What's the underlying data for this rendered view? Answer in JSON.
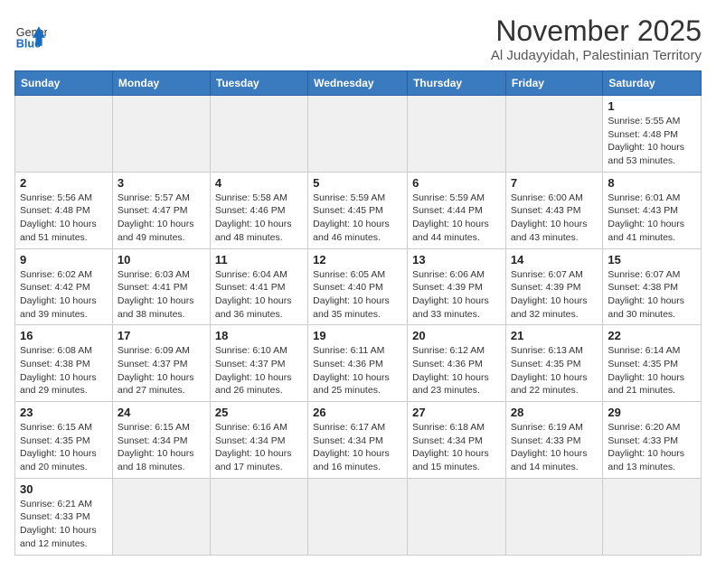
{
  "header": {
    "logo_general": "General",
    "logo_blue": "Blue",
    "month_title": "November 2025",
    "location": "Al Judayyidah, Palestinian Territory"
  },
  "weekdays": [
    "Sunday",
    "Monday",
    "Tuesday",
    "Wednesday",
    "Thursday",
    "Friday",
    "Saturday"
  ],
  "days": {
    "1": {
      "sunrise": "5:55 AM",
      "sunset": "4:48 PM",
      "daylight": "10 hours and 53 minutes."
    },
    "2": {
      "sunrise": "5:56 AM",
      "sunset": "4:48 PM",
      "daylight": "10 hours and 51 minutes."
    },
    "3": {
      "sunrise": "5:57 AM",
      "sunset": "4:47 PM",
      "daylight": "10 hours and 49 minutes."
    },
    "4": {
      "sunrise": "5:58 AM",
      "sunset": "4:46 PM",
      "daylight": "10 hours and 48 minutes."
    },
    "5": {
      "sunrise": "5:59 AM",
      "sunset": "4:45 PM",
      "daylight": "10 hours and 46 minutes."
    },
    "6": {
      "sunrise": "5:59 AM",
      "sunset": "4:44 PM",
      "daylight": "10 hours and 44 minutes."
    },
    "7": {
      "sunrise": "6:00 AM",
      "sunset": "4:43 PM",
      "daylight": "10 hours and 43 minutes."
    },
    "8": {
      "sunrise": "6:01 AM",
      "sunset": "4:43 PM",
      "daylight": "10 hours and 41 minutes."
    },
    "9": {
      "sunrise": "6:02 AM",
      "sunset": "4:42 PM",
      "daylight": "10 hours and 39 minutes."
    },
    "10": {
      "sunrise": "6:03 AM",
      "sunset": "4:41 PM",
      "daylight": "10 hours and 38 minutes."
    },
    "11": {
      "sunrise": "6:04 AM",
      "sunset": "4:41 PM",
      "daylight": "10 hours and 36 minutes."
    },
    "12": {
      "sunrise": "6:05 AM",
      "sunset": "4:40 PM",
      "daylight": "10 hours and 35 minutes."
    },
    "13": {
      "sunrise": "6:06 AM",
      "sunset": "4:39 PM",
      "daylight": "10 hours and 33 minutes."
    },
    "14": {
      "sunrise": "6:07 AM",
      "sunset": "4:39 PM",
      "daylight": "10 hours and 32 minutes."
    },
    "15": {
      "sunrise": "6:07 AM",
      "sunset": "4:38 PM",
      "daylight": "10 hours and 30 minutes."
    },
    "16": {
      "sunrise": "6:08 AM",
      "sunset": "4:38 PM",
      "daylight": "10 hours and 29 minutes."
    },
    "17": {
      "sunrise": "6:09 AM",
      "sunset": "4:37 PM",
      "daylight": "10 hours and 27 minutes."
    },
    "18": {
      "sunrise": "6:10 AM",
      "sunset": "4:37 PM",
      "daylight": "10 hours and 26 minutes."
    },
    "19": {
      "sunrise": "6:11 AM",
      "sunset": "4:36 PM",
      "daylight": "10 hours and 25 minutes."
    },
    "20": {
      "sunrise": "6:12 AM",
      "sunset": "4:36 PM",
      "daylight": "10 hours and 23 minutes."
    },
    "21": {
      "sunrise": "6:13 AM",
      "sunset": "4:35 PM",
      "daylight": "10 hours and 22 minutes."
    },
    "22": {
      "sunrise": "6:14 AM",
      "sunset": "4:35 PM",
      "daylight": "10 hours and 21 minutes."
    },
    "23": {
      "sunrise": "6:15 AM",
      "sunset": "4:35 PM",
      "daylight": "10 hours and 20 minutes."
    },
    "24": {
      "sunrise": "6:15 AM",
      "sunset": "4:34 PM",
      "daylight": "10 hours and 18 minutes."
    },
    "25": {
      "sunrise": "6:16 AM",
      "sunset": "4:34 PM",
      "daylight": "10 hours and 17 minutes."
    },
    "26": {
      "sunrise": "6:17 AM",
      "sunset": "4:34 PM",
      "daylight": "10 hours and 16 minutes."
    },
    "27": {
      "sunrise": "6:18 AM",
      "sunset": "4:34 PM",
      "daylight": "10 hours and 15 minutes."
    },
    "28": {
      "sunrise": "6:19 AM",
      "sunset": "4:33 PM",
      "daylight": "10 hours and 14 minutes."
    },
    "29": {
      "sunrise": "6:20 AM",
      "sunset": "4:33 PM",
      "daylight": "10 hours and 13 minutes."
    },
    "30": {
      "sunrise": "6:21 AM",
      "sunset": "4:33 PM",
      "daylight": "10 hours and 12 minutes."
    }
  }
}
